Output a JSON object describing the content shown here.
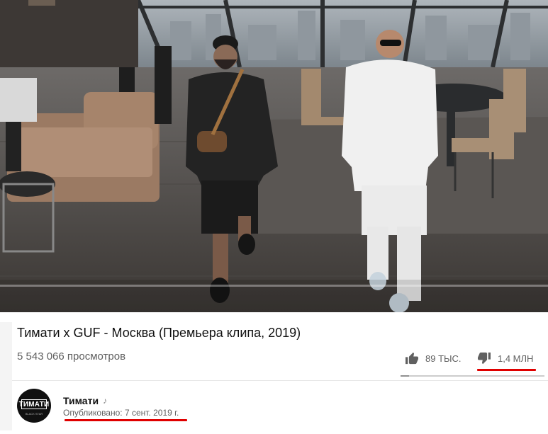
{
  "video": {
    "title": "Тимати x GUF - Москва (Премьера клипа, 2019)",
    "views": "5 543 066 просмотров",
    "likes": "89 ТЫС.",
    "dislikes": "1,4 МЛН",
    "like_dislike_ratio": 0.06
  },
  "channel": {
    "name": "Тимати",
    "avatar_text": "ТИМАТИ",
    "avatar_subtext": "BLACK STAR",
    "note_icon": "music-note-icon",
    "published": "Опубликовано: 7 сент. 2019 г."
  },
  "icons": {
    "like": "thumbs-up-icon",
    "dislike": "thumbs-down-icon"
  },
  "colors": {
    "highlight": "#e00000",
    "text_primary": "#111111",
    "text_secondary": "#606060"
  }
}
